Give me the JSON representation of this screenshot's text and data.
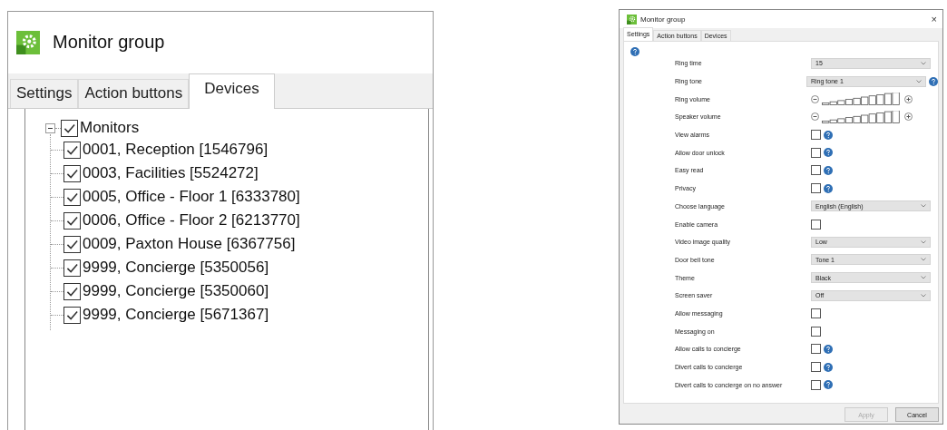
{
  "devices_window": {
    "title": "Monitor group",
    "tabs": [
      {
        "label": "Settings",
        "selected": false
      },
      {
        "label": "Action buttons",
        "selected": false
      },
      {
        "label": "Devices",
        "selected": true
      }
    ],
    "tree": [
      {
        "label": "Monitors",
        "checked": true,
        "expanded": true,
        "children": [
          {
            "label": "0001, Reception [1546796]",
            "checked": true
          },
          {
            "label": "0003, Facilities [5524272]",
            "checked": true
          },
          {
            "label": "0005, Office - Floor 1 [6333780]",
            "checked": true
          },
          {
            "label": "0006, Office - Floor 2 [6213770]",
            "checked": true
          },
          {
            "label": "0009, Paxton House [6367756]",
            "checked": true
          },
          {
            "label": "9999, Concierge [5350056]",
            "checked": true
          },
          {
            "label": "9999, Concierge [5350060]",
            "checked": true
          },
          {
            "label": "9999, Concierge [5671367]",
            "checked": true
          }
        ]
      }
    ]
  },
  "settings_window": {
    "title": "Monitor group",
    "close": "×",
    "tabs": [
      {
        "label": "Settings",
        "selected": true
      },
      {
        "label": "Action buttons",
        "selected": false
      },
      {
        "label": "Devices",
        "selected": false
      }
    ],
    "rows": [
      {
        "kind": "select",
        "label": "Ring time",
        "value": "15",
        "help": false
      },
      {
        "kind": "select",
        "label": "Ring tone",
        "value": "Ring tone 1",
        "help": true
      },
      {
        "kind": "volume",
        "label": "Ring volume"
      },
      {
        "kind": "volume",
        "label": "Speaker volume"
      },
      {
        "kind": "checkbox",
        "label": "View alarms",
        "checked": false,
        "help": true
      },
      {
        "kind": "checkbox",
        "label": "Allow door unlock",
        "checked": false,
        "help": true
      },
      {
        "kind": "checkbox",
        "label": "Easy read",
        "checked": false,
        "help": true
      },
      {
        "kind": "checkbox",
        "label": "Privacy",
        "checked": false,
        "help": true
      },
      {
        "kind": "select",
        "label": "Choose language",
        "value": "English (English)",
        "help": false
      },
      {
        "kind": "checkbox",
        "label": "Enable camera",
        "checked": false,
        "help": false
      },
      {
        "kind": "select",
        "label": "Video image quality",
        "value": "Low",
        "help": false
      },
      {
        "kind": "select",
        "label": "Door bell tone",
        "value": "Tone 1",
        "help": false
      },
      {
        "kind": "select",
        "label": "Theme",
        "value": "Black",
        "help": false
      },
      {
        "kind": "select",
        "label": "Screen saver",
        "value": "Off",
        "help": false
      },
      {
        "kind": "checkbox",
        "label": "Allow messaging",
        "checked": false,
        "help": false
      },
      {
        "kind": "checkbox",
        "label": "Messaging on",
        "checked": false,
        "help": false
      },
      {
        "kind": "checkbox",
        "label": "Allow calls to concierge",
        "checked": false,
        "help": true
      },
      {
        "kind": "checkbox",
        "label": "Divert calls to concierge",
        "checked": false,
        "help": true
      },
      {
        "kind": "checkbox",
        "label": "Divert calls to concierge on no answer",
        "checked": false,
        "help": true
      }
    ],
    "buttons": [
      {
        "label": "Apply",
        "disabled": true
      },
      {
        "label": "Cancel",
        "disabled": false
      }
    ]
  }
}
